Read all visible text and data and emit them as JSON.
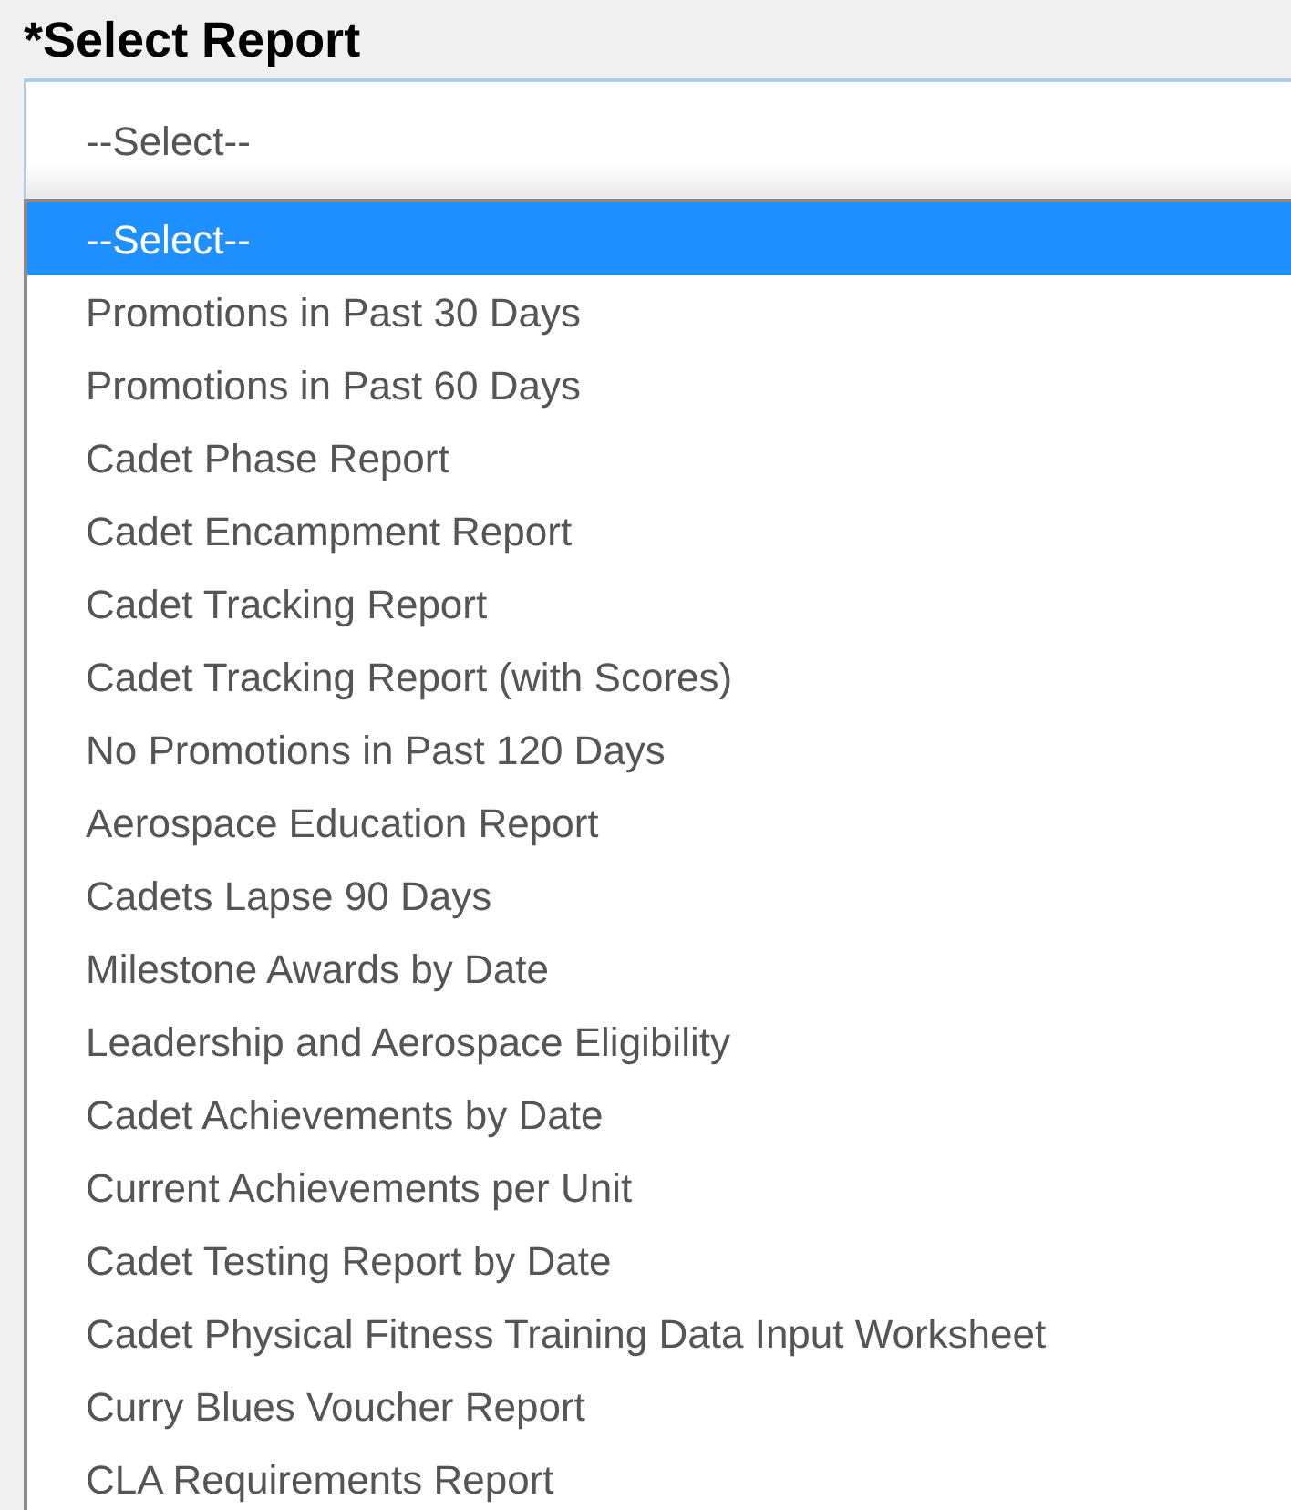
{
  "label": "*Select Report",
  "field": {
    "value": "--Select--"
  },
  "options": [
    {
      "label": "--Select--",
      "selected": true
    },
    {
      "label": "Promotions in Past 30 Days",
      "selected": false
    },
    {
      "label": "Promotions in Past 60 Days",
      "selected": false
    },
    {
      "label": "Cadet Phase Report",
      "selected": false
    },
    {
      "label": "Cadet Encampment Report",
      "selected": false
    },
    {
      "label": "Cadet Tracking Report",
      "selected": false
    },
    {
      "label": "Cadet Tracking Report (with Scores)",
      "selected": false
    },
    {
      "label": "No Promotions in Past 120 Days",
      "selected": false
    },
    {
      "label": "Aerospace Education Report",
      "selected": false
    },
    {
      "label": "Cadets Lapse 90 Days",
      "selected": false
    },
    {
      "label": "Milestone Awards by Date",
      "selected": false
    },
    {
      "label": "Leadership and Aerospace Eligibility",
      "selected": false
    },
    {
      "label": "Cadet Achievements by Date",
      "selected": false
    },
    {
      "label": "Current Achievements per Unit",
      "selected": false
    },
    {
      "label": "Cadet Testing Report by Date",
      "selected": false
    },
    {
      "label": "Cadet Physical Fitness Training Data Input Worksheet",
      "selected": false
    },
    {
      "label": "Curry Blues Voucher Report",
      "selected": false
    },
    {
      "label": "CLA Requirements Report",
      "selected": false
    }
  ]
}
